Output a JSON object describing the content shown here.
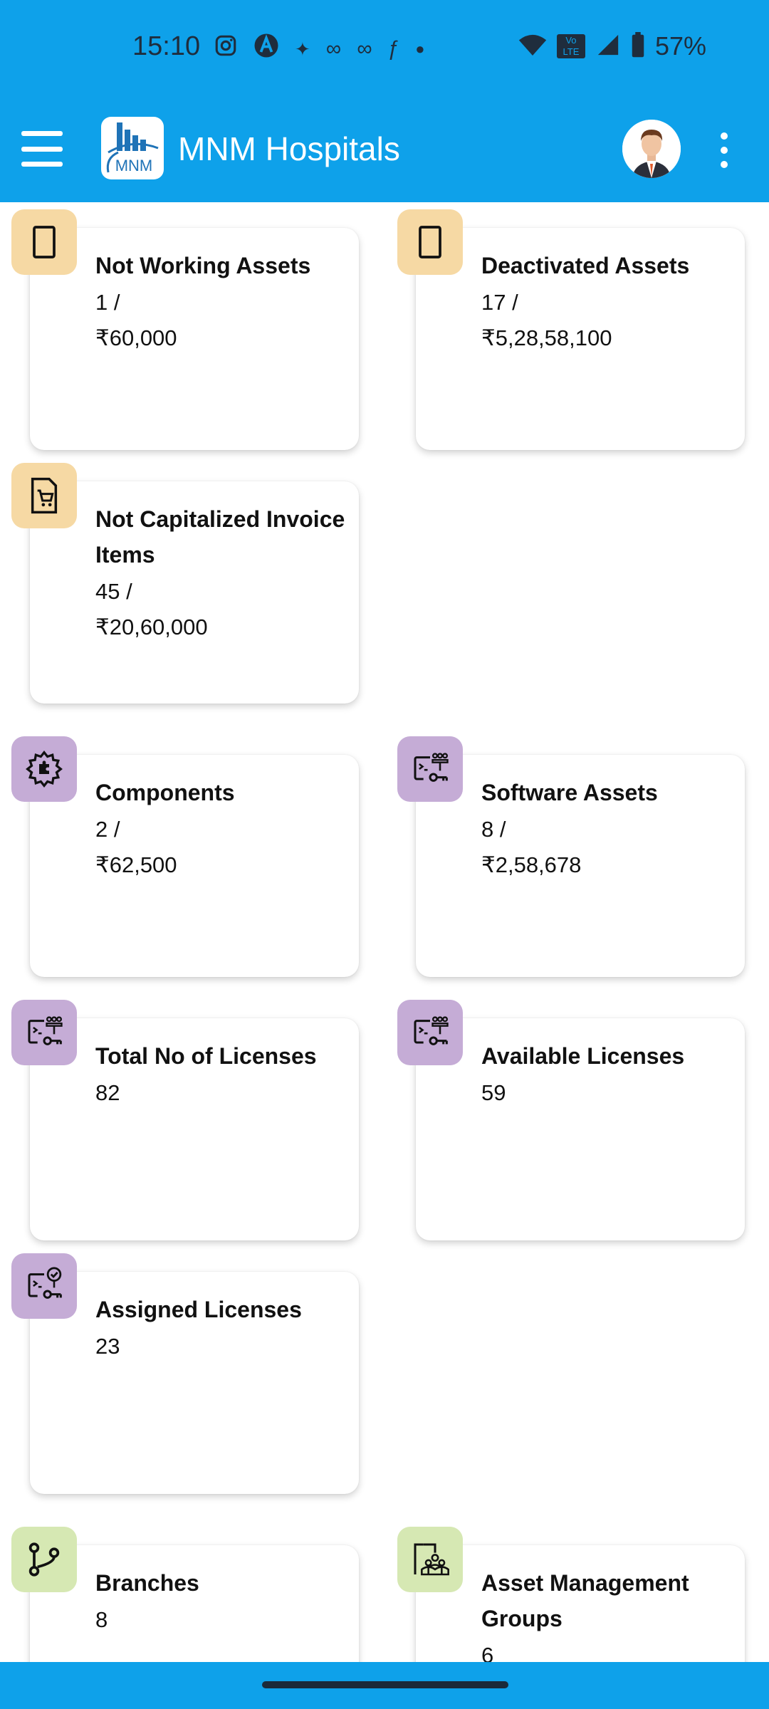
{
  "status": {
    "time": "15:10",
    "battery": "57%",
    "network": "Vo LTE",
    "icons": [
      "instagram-icon",
      "app-a-icon",
      "app-icon",
      "app-icon",
      "app-icon",
      "flipkart-icon",
      "dot-icon"
    ]
  },
  "header": {
    "title": "MNM Hospitals",
    "logo_text": "MNM"
  },
  "cards": [
    {
      "title": "Not Working Assets",
      "line1": "1 /",
      "line2": "₹60,000",
      "icon": "device-icon",
      "color": "#f6d9a4"
    },
    {
      "title": "Deactivated Assets",
      "line1": "17 /",
      "line2": "₹5,28,58,100",
      "icon": "device-icon",
      "color": "#f6d9a4"
    },
    {
      "title": "Not Capitalized Invoice Items",
      "line1": "45 /",
      "line2": "₹20,60,000",
      "icon": "invoice-cart-icon",
      "color": "#f6d9a4"
    },
    {
      "title": "Components",
      "line1": "2 /",
      "line2": "₹62,500",
      "icon": "gear-puzzle-icon",
      "color": "#c5acd6"
    },
    {
      "title": "Software Assets",
      "line1": "8 /",
      "line2": "₹2,58,678",
      "icon": "software-license-icon",
      "color": "#c5acd6"
    },
    {
      "title": "Total No of Licenses",
      "line1": "82",
      "icon": "software-license-icon",
      "color": "#c5acd6"
    },
    {
      "title": "Available Licenses",
      "line1": "59",
      "icon": "software-license-icon",
      "color": "#c5acd6"
    },
    {
      "title": "Assigned Licenses",
      "line1": "23",
      "icon": "assigned-license-icon",
      "color": "#c5acd6"
    },
    {
      "title": "Branches",
      "line1": "8",
      "icon": "branch-icon",
      "color": "#d6e8b3"
    },
    {
      "title": "Asset Management Groups",
      "line1": "6",
      "icon": "group-icon",
      "color": "#d6e8b3"
    }
  ]
}
